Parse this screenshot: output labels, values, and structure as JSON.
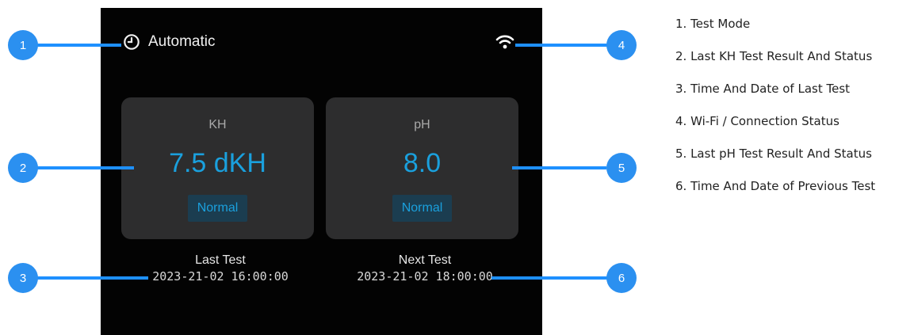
{
  "screen": {
    "mode_icon": "clock-icon",
    "mode_label": "Automatic",
    "wifi_icon": "wifi-icon",
    "kh": {
      "label": "KH",
      "value": "7.5 dKH",
      "status": "Normal"
    },
    "ph": {
      "label": "pH",
      "value": "8.0",
      "status": "Normal"
    },
    "last_test": {
      "label": "Last Test",
      "time": "2023-21-02 16:00:00"
    },
    "next_test": {
      "label": "Next Test",
      "time": "2023-21-02 18:00:00"
    }
  },
  "markers": [
    "1",
    "2",
    "3",
    "4",
    "5",
    "6"
  ],
  "legend": [
    "1. Test Mode",
    "2. Last KH Test Result And Status",
    "3. Time And Date of Last Test",
    "4. Wi-Fi / Connection Status",
    "5. Last pH Test Result And Status",
    "6. Time And Date of Previous Test"
  ],
  "colors": {
    "accent": "#1aa0dd",
    "marker": "#2b90f0",
    "card": "#2d2d2e",
    "badge_bg": "#1b3d50"
  }
}
